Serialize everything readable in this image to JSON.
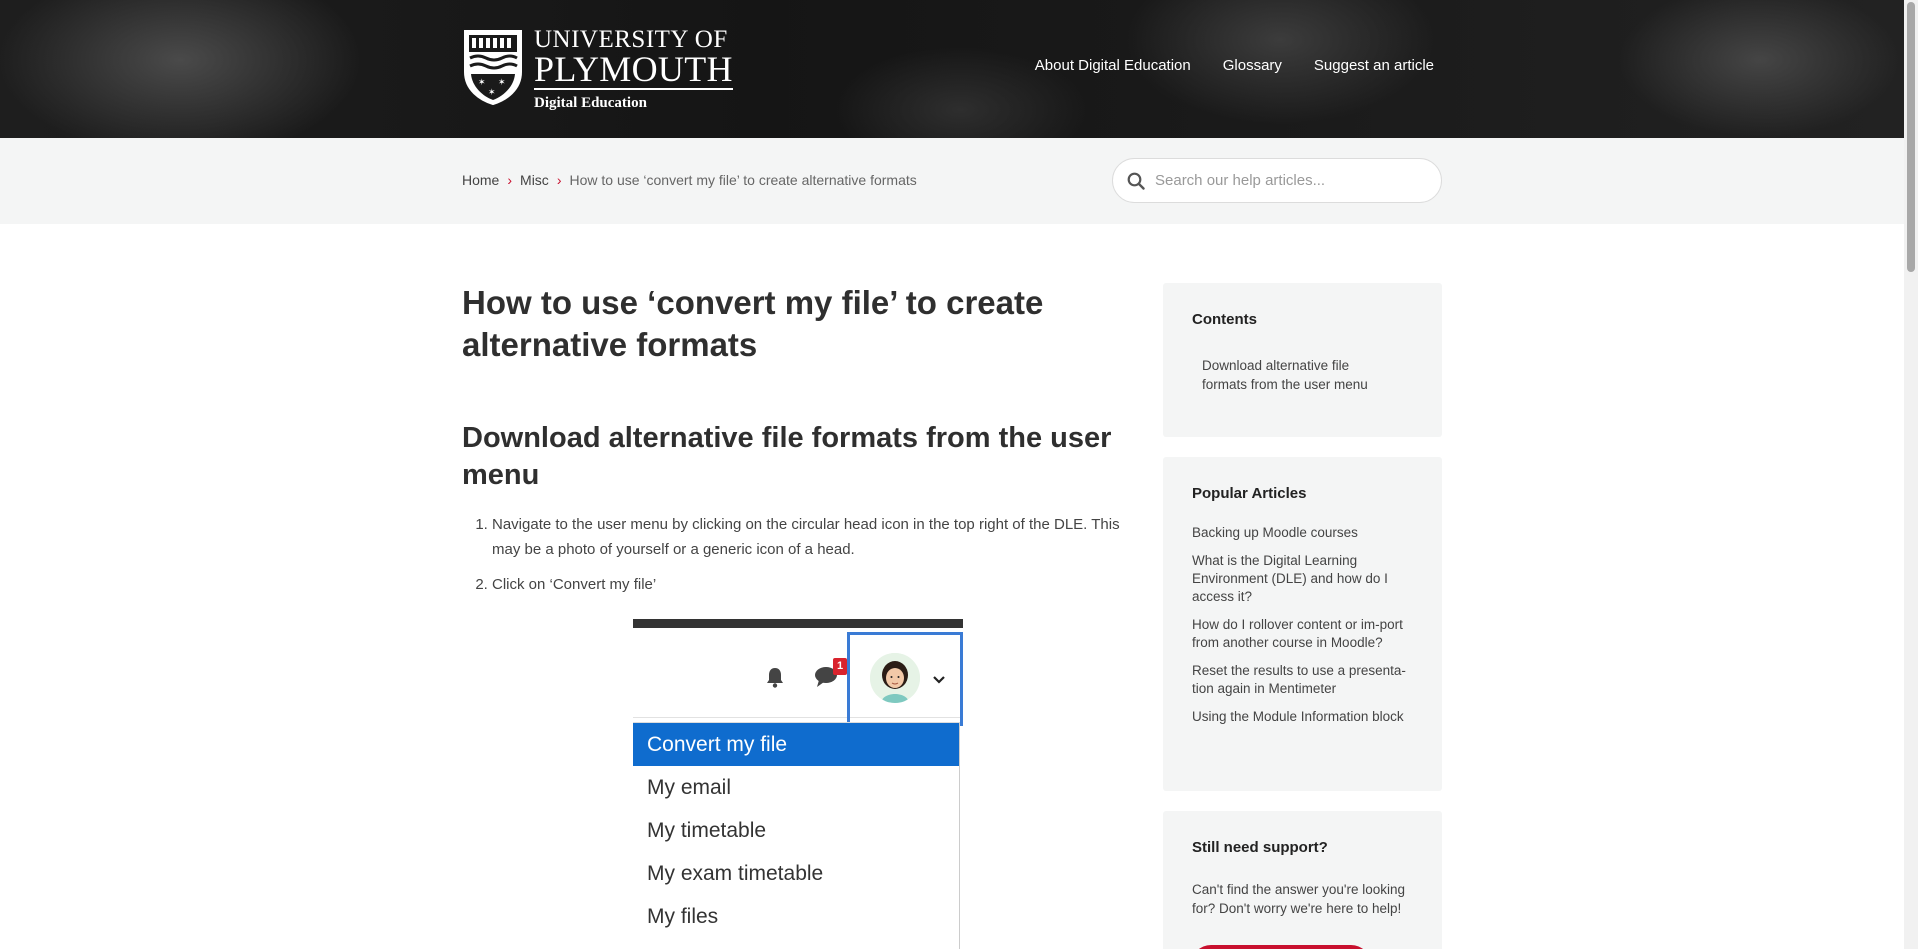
{
  "header": {
    "logo": {
      "line1": "UNIVERSITY OF",
      "line2": "PLYMOUTH",
      "line3": "Digital Education"
    },
    "nav": [
      {
        "label": "About Digital Education"
      },
      {
        "label": "Glossary"
      },
      {
        "label": "Suggest an article"
      }
    ]
  },
  "breadcrumb": {
    "items": [
      {
        "label": "Home"
      },
      {
        "label": "Misc"
      }
    ],
    "current": "How to use ‘convert my file’ to create alternative formats"
  },
  "search": {
    "placeholder": "Search our help articles...",
    "value": ""
  },
  "article": {
    "title": "How to use ‘convert my file’ to create alternative formats",
    "section_heading": "Download alternative file formats from the user menu",
    "steps": [
      "Navigate to the user menu by clicking on the circular head icon in the top right of the DLE. This may be a photo of yourself or a generic icon of a head.",
      "Click on ‘Convert my file’"
    ],
    "figure": {
      "badge_count": "1",
      "menu_items": [
        {
          "label": "Convert my file",
          "active": true
        },
        {
          "label": "My email",
          "active": false
        },
        {
          "label": "My timetable",
          "active": false
        },
        {
          "label": "My exam timetable",
          "active": false
        },
        {
          "label": "My files",
          "active": false
        }
      ]
    }
  },
  "sidebar": {
    "contents": {
      "title": "Contents",
      "links": [
        {
          "label": "Download alternative file formats from the user menu"
        }
      ]
    },
    "popular": {
      "title": "Popular Articles",
      "links": [
        {
          "label": "Backing up Moodle courses"
        },
        {
          "label": "What is the Digital Learning Environment (DLE) and how do I access it?"
        },
        {
          "label": "How do I rollover content or im-port from another course in Moodle?"
        },
        {
          "label": "Reset the results to use a presenta-tion again in Mentimeter"
        },
        {
          "label": "Using the Module Information block"
        }
      ]
    },
    "support": {
      "title": "Still need support?",
      "text": "Can't find the answer you're looking for? Don't worry we're here to help!"
    }
  },
  "colors": {
    "accent_red": "#c8102e",
    "menu_active_blue": "#0f6cce",
    "highlight_border": "#3a7bd5",
    "panel_bg": "#f4f5f5"
  }
}
